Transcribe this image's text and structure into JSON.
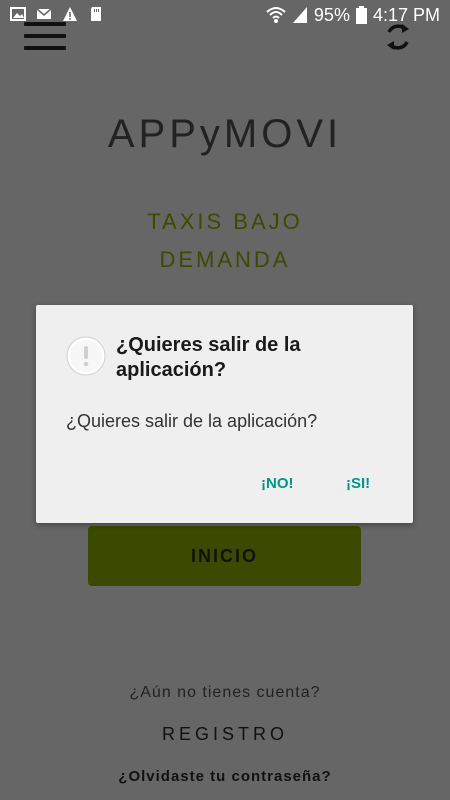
{
  "status_bar": {
    "battery": "95%",
    "time": "4:17 PM",
    "left_icons": [
      "image-icon",
      "mail-icon",
      "warning-icon",
      "sd-card-icon"
    ],
    "right_icons": [
      "wifi-icon",
      "signal-icon",
      "battery-icon"
    ]
  },
  "header": {
    "menu_icon": "hamburger-icon",
    "refresh_icon": "refresh-icon"
  },
  "brand": {
    "name": "APPyMOVI",
    "tagline_line1": "TAXIS BAJO",
    "tagline_line2": "DEMANDA"
  },
  "dialog": {
    "title": "¿Quieres salir de la aplicación?",
    "message": "¿Quieres salir de la aplicación?",
    "negative": "¡NO!",
    "positive": "¡SI!",
    "icon": "info-icon"
  },
  "actions": {
    "start": "INICIO",
    "no_account": "¿Aún no tienes cuenta?",
    "register": "REGISTRO",
    "forgot": "¿Olvidaste tu contraseña?"
  },
  "colors": {
    "overlay": "#666666",
    "accent": "#00968a",
    "button": "#3b4a00"
  }
}
